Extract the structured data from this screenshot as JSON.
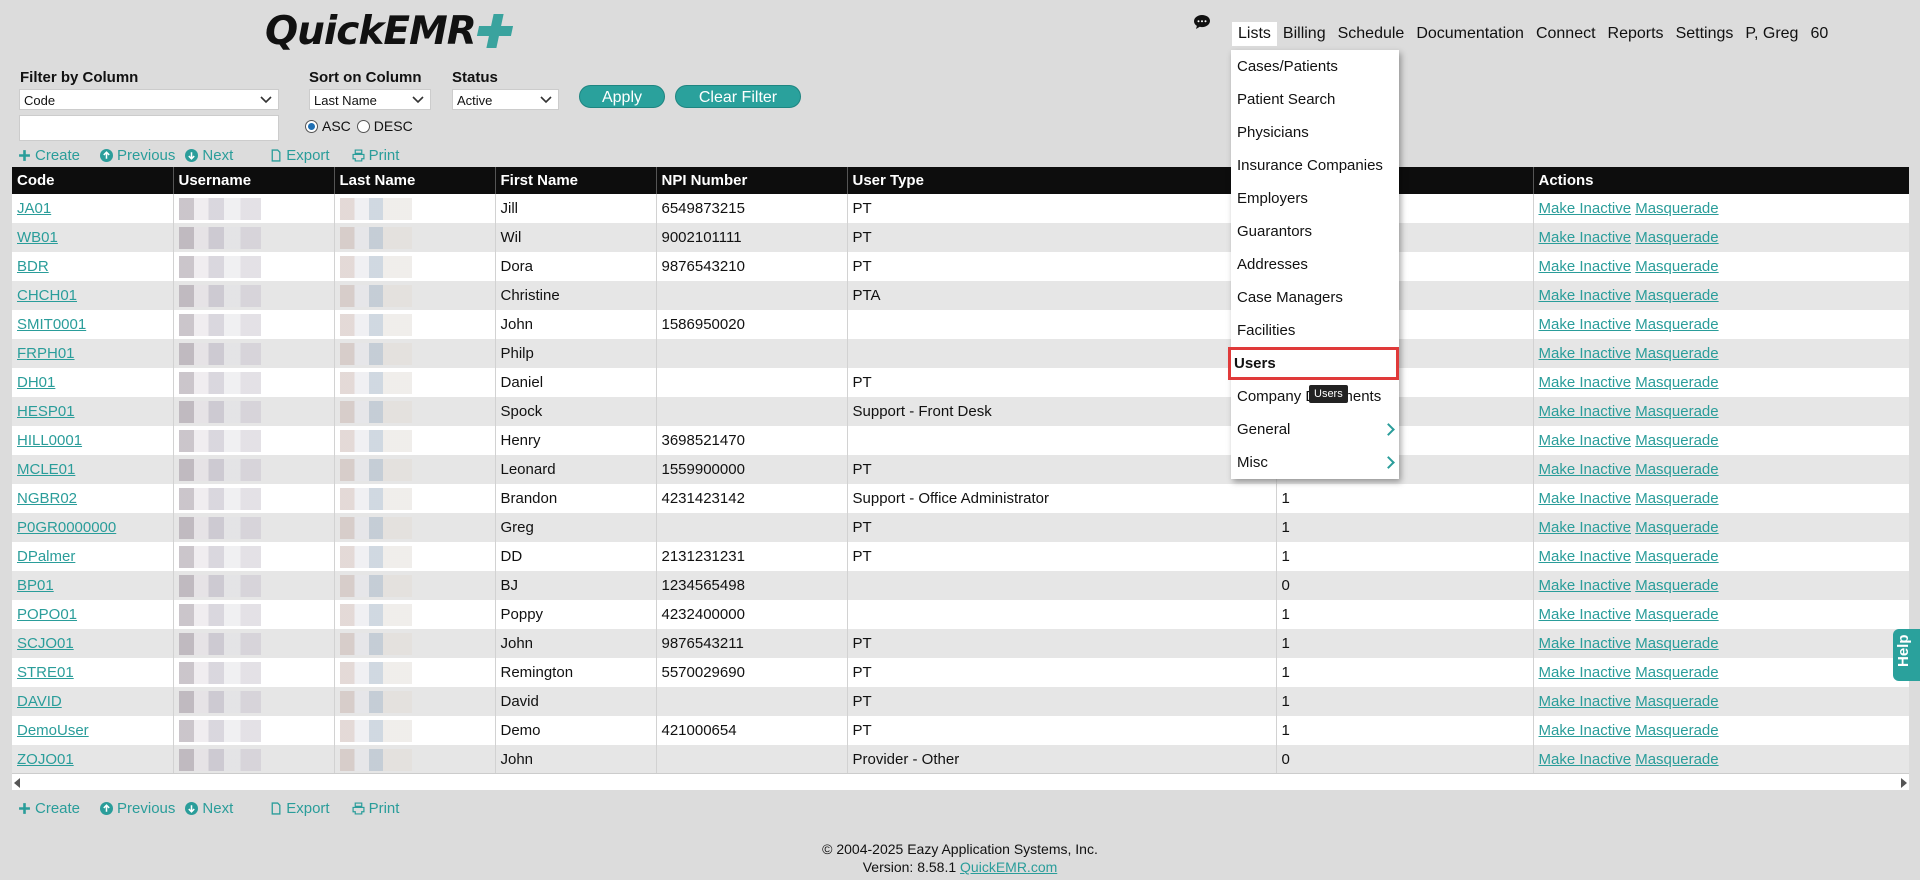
{
  "brand": {
    "name_part1": "Quick",
    "name_part2": "EMR"
  },
  "nav": {
    "items": [
      "Lists",
      "Billing",
      "Schedule",
      "Documentation",
      "Connect",
      "Reports",
      "Settings"
    ],
    "user": "P, Greg",
    "count": "60"
  },
  "filters": {
    "filter_label": "Filter by Column",
    "filter_value": "Code",
    "sort_label": "Sort on Column",
    "sort_value": "Last Name",
    "status_label": "Status",
    "status_value": "Active",
    "asc": "ASC",
    "desc": "DESC",
    "apply": "Apply",
    "clear": "Clear Filter"
  },
  "toolbar": {
    "create": "Create",
    "previous": "Previous",
    "next": "Next",
    "export": "Export",
    "print": "Print"
  },
  "table": {
    "columns": [
      "Code",
      "Username",
      "Last Name",
      "First Name",
      "NPI Number",
      "User Type",
      "",
      "Actions"
    ],
    "actions": {
      "inactive": "Make Inactive",
      "masquerade": "Masquerade"
    },
    "rows": [
      {
        "code": "JA01",
        "first": "Jill",
        "npi": "6549873215",
        "type": "PT",
        "num": ""
      },
      {
        "code": "WB01",
        "first": "Wil",
        "npi": "9002101111",
        "type": "PT",
        "num": ""
      },
      {
        "code": "BDR",
        "first": "Dora",
        "npi": "9876543210",
        "type": "PT",
        "num": ""
      },
      {
        "code": "CHCH01",
        "first": "Christine",
        "npi": "",
        "type": "PTA",
        "num": ""
      },
      {
        "code": "SMIT0001",
        "first": "John",
        "npi": "1586950020",
        "type": "",
        "num": ""
      },
      {
        "code": "FRPH01",
        "first": "Philp",
        "npi": "",
        "type": "",
        "num": ""
      },
      {
        "code": "DH01",
        "first": "Daniel",
        "npi": "",
        "type": "PT",
        "num": ""
      },
      {
        "code": "HESP01",
        "first": "Spock",
        "npi": "",
        "type": "Support - Front Desk",
        "num": ""
      },
      {
        "code": "HILL0001",
        "first": "Henry",
        "npi": "3698521470",
        "type": "",
        "num": ""
      },
      {
        "code": "MCLE01",
        "first": "Leonard",
        "npi": "1559900000",
        "type": "PT",
        "num": ""
      },
      {
        "code": "NGBR02",
        "first": "Brandon",
        "npi": "4231423142",
        "type": "Support - Office Administrator",
        "num": "1"
      },
      {
        "code": "P0GR0000000",
        "first": "Greg",
        "npi": "",
        "type": "PT",
        "num": "1"
      },
      {
        "code": "DPalmer",
        "first": "DD",
        "npi": "2131231231",
        "type": "PT",
        "num": "1"
      },
      {
        "code": "BP01",
        "first": "BJ",
        "npi": "1234565498",
        "type": "",
        "num": "0"
      },
      {
        "code": "POPO01",
        "first": "Poppy",
        "npi": "4232400000",
        "type": "",
        "num": "1"
      },
      {
        "code": "SCJO01",
        "first": "John",
        "npi": "9876543211",
        "type": "PT",
        "num": "1"
      },
      {
        "code": "STRE01",
        "first": "Remington",
        "npi": "5570029690",
        "type": "PT",
        "num": "1"
      },
      {
        "code": "DAVID",
        "first": "David",
        "npi": "",
        "type": "PT",
        "num": "1"
      },
      {
        "code": "DemoUser",
        "first": "Demo",
        "npi": "421000654",
        "type": "PT",
        "num": "1"
      },
      {
        "code": "ZOJO01",
        "first": "John",
        "npi": "",
        "type": "Provider - Other",
        "num": "0"
      }
    ]
  },
  "menu": {
    "items": [
      "Cases/Patients",
      "Patient Search",
      "Physicians",
      "Insurance Companies",
      "Employers",
      "Guarantors",
      "Addresses",
      "Case Managers",
      "Facilities",
      "Users",
      "Company Documents",
      "General",
      "Misc"
    ],
    "tooltip": "Users"
  },
  "help": "Help",
  "footer": {
    "copyright": "© 2004-2025 Eazy Application Systems, Inc.",
    "version": "Version: 8.58.1",
    "link": "QuickEMR.com"
  }
}
